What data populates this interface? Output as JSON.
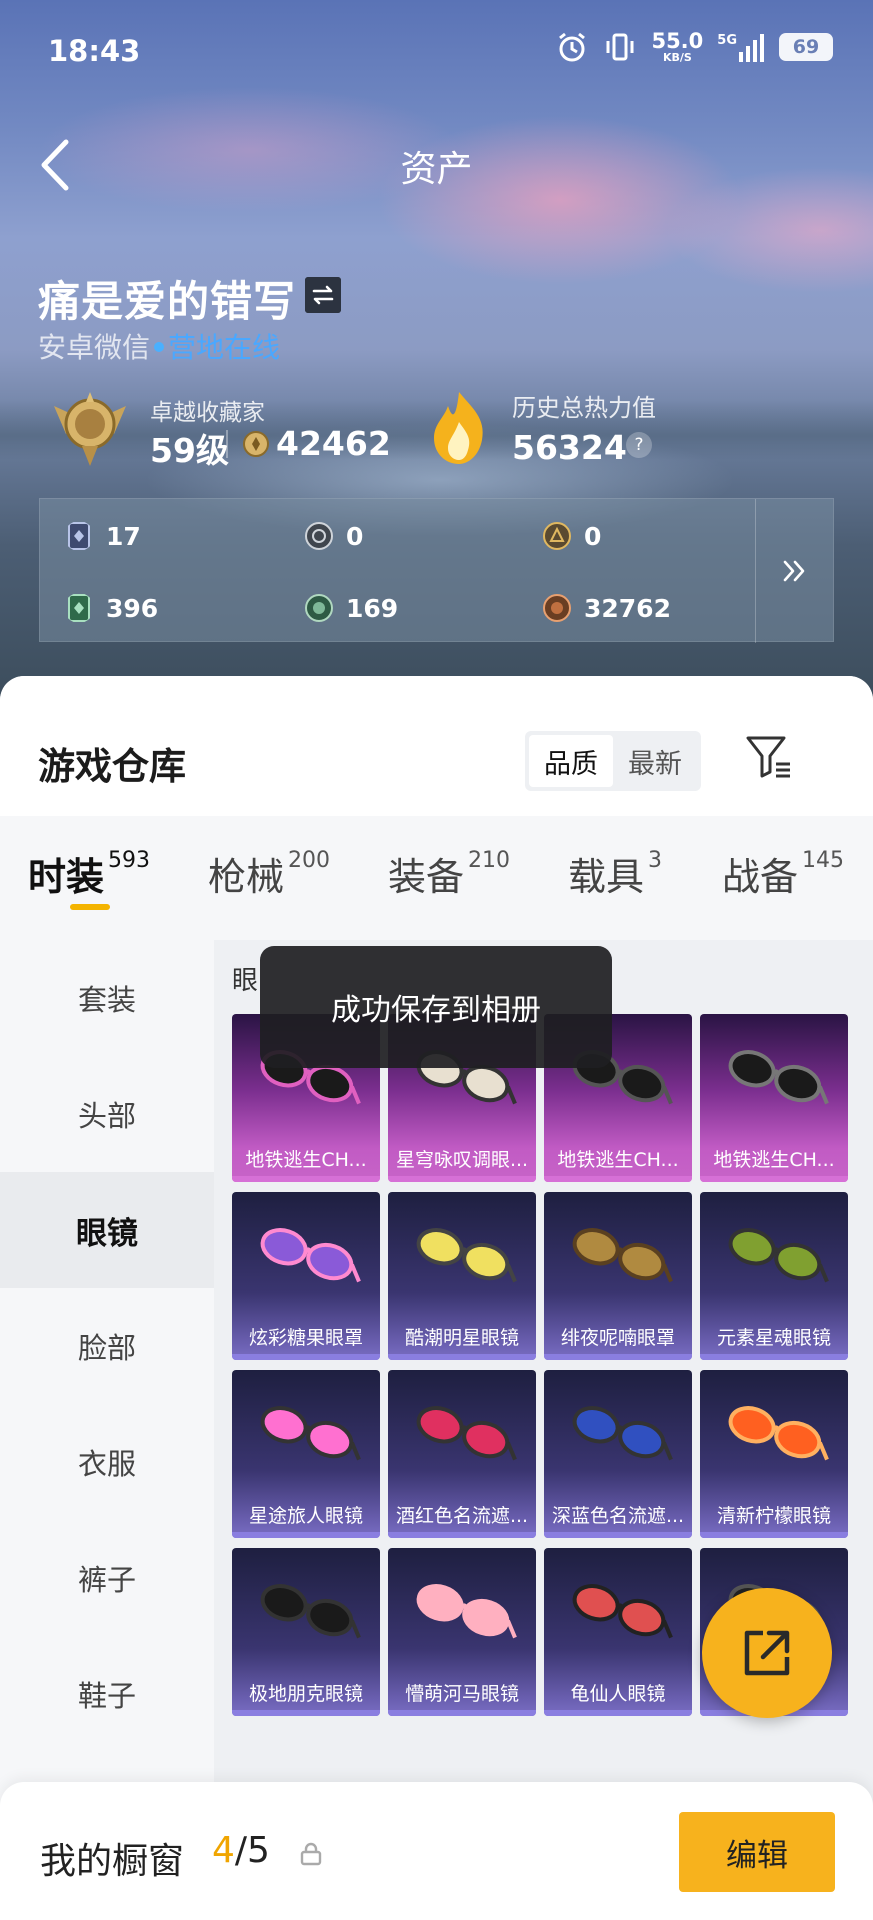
{
  "status_bar": {
    "time": "18:43",
    "net_speed_value": "55.0",
    "net_speed_unit": "KB/S",
    "signal": "5G",
    "battery": "69"
  },
  "nav": {
    "title": "资产"
  },
  "profile": {
    "name": "痛是爱的错写",
    "platform": "安卓微信",
    "online_status": "营地在线",
    "collector_label": "卓越收藏家",
    "collector_level": "59级",
    "collector_points": "42462",
    "heat_label": "历史总热力值",
    "heat_value": "56324",
    "help": "?"
  },
  "currencies": [
    {
      "icon": "card-icon",
      "value": "17"
    },
    {
      "icon": "silver-coin-icon",
      "value": "0"
    },
    {
      "icon": "gold-badge-icon",
      "value": "0"
    },
    {
      "icon": "green-card-icon",
      "value": "396"
    },
    {
      "icon": "green-coin-icon",
      "value": "169"
    },
    {
      "icon": "bronze-coin-icon",
      "value": "32762"
    }
  ],
  "warehouse": {
    "title": "游戏仓库",
    "sort_quality": "品质",
    "sort_latest": "最新"
  },
  "category_tabs": [
    {
      "label": "时装",
      "count": "593",
      "active": true
    },
    {
      "label": "枪械",
      "count": "200"
    },
    {
      "label": "装备",
      "count": "210"
    },
    {
      "label": "载具",
      "count": "3"
    },
    {
      "label": "战备",
      "count": "145"
    }
  ],
  "sidebar": [
    {
      "label": "套装"
    },
    {
      "label": "头部"
    },
    {
      "label": "眼镜",
      "active": true
    },
    {
      "label": "脸部"
    },
    {
      "label": "衣服"
    },
    {
      "label": "裤子"
    },
    {
      "label": "鞋子"
    }
  ],
  "grid": {
    "title_partial": "眼",
    "items": [
      {
        "name": "地铁逃生CH...",
        "rarity": "purple"
      },
      {
        "name": "星穹咏叹调眼...",
        "rarity": "purple"
      },
      {
        "name": "地铁逃生CH...",
        "rarity": "purple"
      },
      {
        "name": "地铁逃生CH...",
        "rarity": "purple"
      },
      {
        "name": "炫彩糖果眼罩",
        "rarity": "blue"
      },
      {
        "name": "酷潮明星眼镜",
        "rarity": "blue"
      },
      {
        "name": "绯夜呢喃眼罩",
        "rarity": "blue"
      },
      {
        "name": "元素星魂眼镜",
        "rarity": "blue"
      },
      {
        "name": "星途旅人眼镜",
        "rarity": "blue"
      },
      {
        "name": "酒红色名流遮...",
        "rarity": "blue"
      },
      {
        "name": "深蓝色名流遮...",
        "rarity": "blue"
      },
      {
        "name": "清新柠檬眼镜",
        "rarity": "blue"
      },
      {
        "name": "极地朋克眼镜",
        "rarity": "blue"
      },
      {
        "name": "懵萌河马眼镜",
        "rarity": "blue"
      },
      {
        "name": "龟仙人眼镜",
        "rarity": "blue"
      },
      {
        "name": "镜",
        "rarity": "blue"
      }
    ]
  },
  "toast": {
    "message": "成功保存到相册"
  },
  "bottom": {
    "showcase_label": "我的橱窗",
    "showcase_current": "4",
    "showcase_sep": "/",
    "showcase_max": "5",
    "edit_label": "编辑"
  },
  "colors": {
    "accent": "#f7b21d",
    "online": "#4aa8ff"
  }
}
